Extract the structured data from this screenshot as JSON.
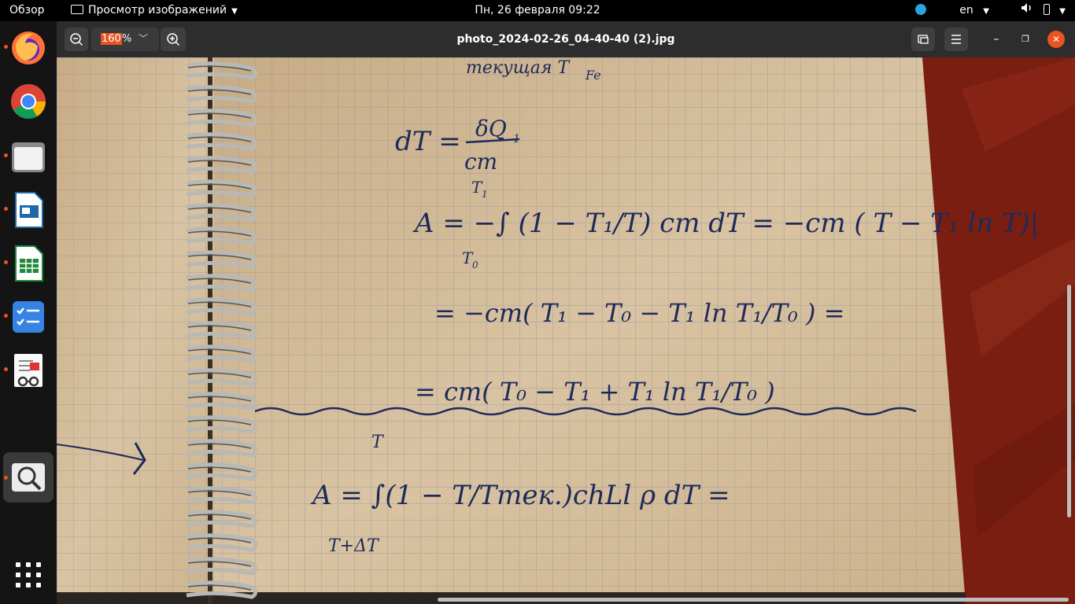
{
  "topbar": {
    "activities": "Обзор",
    "app_name": "Просмотр изображений",
    "datetime": "Пн, 26 февраля  09:22",
    "keyboard_layout": "en",
    "tray_icons": [
      "telegram-icon",
      "volume-icon",
      "battery-icon"
    ]
  },
  "dock": {
    "apps": [
      {
        "name": "firefox",
        "running": true
      },
      {
        "name": "chrome",
        "running": false
      },
      {
        "name": "files",
        "running": true
      },
      {
        "name": "impress",
        "running": true
      },
      {
        "name": "calc",
        "running": true
      },
      {
        "name": "tasks",
        "running": true
      },
      {
        "name": "document-viewer",
        "running": true
      },
      {
        "name": "image-viewer",
        "running": true,
        "active": true
      }
    ]
  },
  "viewer": {
    "zoom_value": "160",
    "zoom_unit": "%",
    "file_title": "photo_2024-02-26_04-40-40 (2).jpg"
  },
  "image_text": {
    "top_partial": "текущая T",
    "top_sub": "Fe",
    "eq1_lhs": "dT =",
    "eq1_num": "δQ",
    "eq1_num_sub": "1",
    "eq1_den": "cm",
    "eq2_lower": "T",
    "eq2_lower_sub": "0",
    "eq2_upper": "T",
    "eq2_upper_sub": "1",
    "eq2_text": "A = −∫ (1 − T₁/T) cm dT = −cm ( T − T₁ ln T)|",
    "eq3_text": "= −cm( T₁ − T₀ − T₁ ln T₁/T₀ ) =",
    "eq4_text": "= cm( T₀ − T₁ + T₁ ln T₁/T₀ )",
    "eq5_upper": "T",
    "eq5_lower": "T+ΔT",
    "eq5_text": "A = ∫(1 − T/Tтек.)chLl ρ dT =",
    "eq5_den": "Tтек."
  },
  "colors": {
    "accent": "#e95420",
    "paper": "#d8c3a3",
    "grid": "#8f9aa6",
    "ink": "#1e2a5a",
    "wood": "#7a1e12"
  }
}
